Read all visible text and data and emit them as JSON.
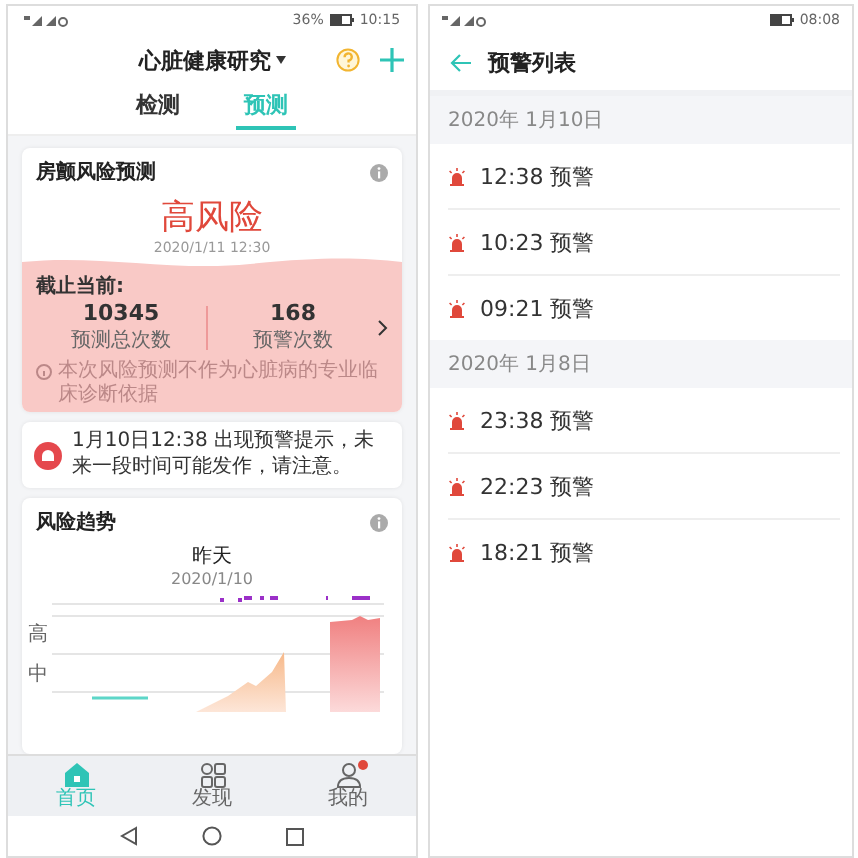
{
  "left_screen": {
    "status_bar": {
      "battery": "36%",
      "time": "10:15"
    },
    "header": {
      "title": "心脏健康研究"
    },
    "tabs": [
      {
        "label": "检测",
        "selected": false
      },
      {
        "label": "预测",
        "selected": true
      }
    ],
    "risk_card": {
      "title": "房颤风险预测",
      "risk_level": "高风险",
      "date": "2020/1/11 12:30",
      "as_of_label": "截止当前:",
      "stats": [
        {
          "value": "10345",
          "label": "预测总次数"
        },
        {
          "value": "168",
          "label": "预警次数"
        }
      ],
      "disclaimer": "本次风险预测不作为心脏病的专业临床诊断依据"
    },
    "alert": {
      "text": "1月10日12:38 出现预警提示，未来一段时间可能发作，请注意。"
    },
    "trend_card": {
      "title": "风险趋势",
      "day": "昨天",
      "date": "2020/1/10",
      "y_labels": [
        "高",
        "中"
      ]
    },
    "bottom_nav": [
      {
        "label": "首页",
        "selected": true,
        "badge": false
      },
      {
        "label": "发现",
        "selected": false,
        "badge": false
      },
      {
        "label": "我的",
        "selected": false,
        "badge": true
      }
    ]
  },
  "right_screen": {
    "status_bar": {
      "time": "08:08"
    },
    "title": "预警列表",
    "groups": [
      {
        "date": "2020年 1月10日",
        "items": [
          "12:38 预警",
          "10:23 预警",
          "09:21 预警"
        ]
      },
      {
        "date": "2020年 1月8日",
        "items": [
          "23:38 预警",
          "22:23 预警",
          "18:21 预警"
        ]
      }
    ]
  }
}
